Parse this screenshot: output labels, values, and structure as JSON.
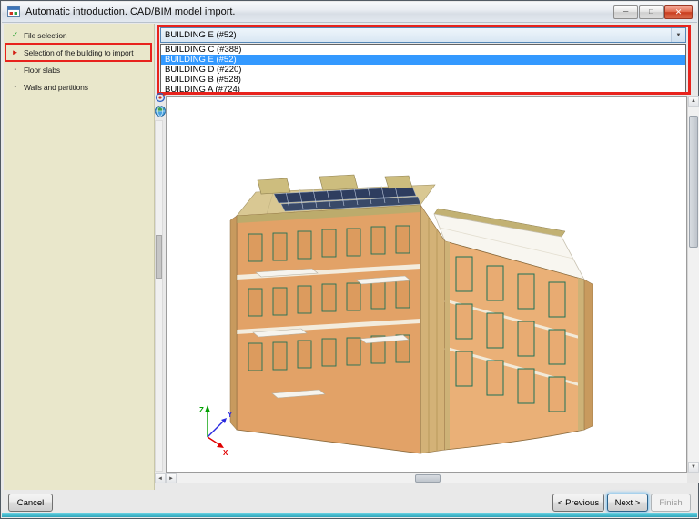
{
  "window": {
    "title": "Automatic introduction. CAD/BIM model import."
  },
  "icons": {
    "minimize": "─",
    "maximize": "□",
    "close": "✕",
    "check": "✓",
    "arrow": "►",
    "dot": "▪",
    "combo_arrow": "▼",
    "up": "▲",
    "down": "▼",
    "left": "◄",
    "right": "►"
  },
  "sidebar": {
    "items": [
      {
        "label": "File selection"
      },
      {
        "label": "Selection of the building to import"
      },
      {
        "label": "Floor slabs"
      },
      {
        "label": "Walls and partitions"
      }
    ]
  },
  "building_select": {
    "value": "BUILDING E (#52)",
    "selected_index": 1,
    "options": [
      {
        "label": "BUILDING C (#388)"
      },
      {
        "label": "BUILDING E (#52)"
      },
      {
        "label": "BUILDING D (#220)"
      },
      {
        "label": "BUILDING B (#528)"
      },
      {
        "label": "BUILDING A (#724)"
      }
    ]
  },
  "viewport": {
    "axis": {
      "x": "X",
      "y": "Y",
      "z": "Z"
    }
  },
  "footer": {
    "cancel": "Cancel",
    "previous": "< Previous",
    "next": "Next >",
    "finish": "Finish"
  },
  "colors": {
    "annotation_red": "#e8231d",
    "selection_blue": "#3399ff",
    "sidebar_bg": "#e9e7cb",
    "wall_tan": "#e2a267",
    "roof_navy": "#2e3d5f"
  }
}
